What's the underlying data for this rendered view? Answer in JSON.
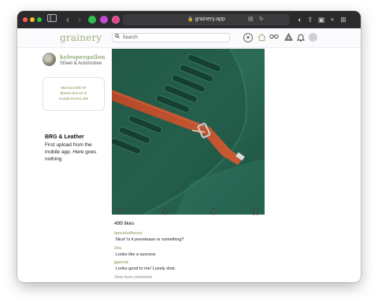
{
  "browser": {
    "url": "grainery.app",
    "icons": {
      "sidebar": "sidebar-icon",
      "back": "chevron-left-icon",
      "forward": "chevron-right-icon",
      "reader": "reader-icon",
      "reload": "reload-icon",
      "shield": "shield-icon",
      "share": "share-icon",
      "new_tab": "plus-icon",
      "tabs": "tab-overview-icon"
    }
  },
  "app": {
    "logo": "grainery",
    "search_placeholder": "Search",
    "brand_color": "#9db07a",
    "nav_icons": [
      "compass-icon",
      "home-icon",
      "glasses-icon",
      "triangle-icon",
      "bell-icon",
      "avatar"
    ]
  },
  "profile": {
    "username": "kylespergallon",
    "category": "Street & Automotive",
    "gear": [
      "Mamiya 645 AF",
      "80mm f2.8 AF D",
      "Kodak Portra 400"
    ]
  },
  "post": {
    "title": "BRG & Leather",
    "description": "First upload from the mobile app. Here goes nothing",
    "likes": "499 likes",
    "actions": [
      "heart-icon",
      "comment-icon",
      "circle-icon",
      "bookmark-icon"
    ],
    "comments": [
      {
        "user": "lancelotfocus",
        "text": "Nice! Is it prerelease or something?"
      },
      {
        "user": "2xu",
        "text": "Looks like a success"
      },
      {
        "user": "jgarcia",
        "text": "Looks good to me! Lovely shot."
      }
    ],
    "view_more": "View more comments"
  }
}
